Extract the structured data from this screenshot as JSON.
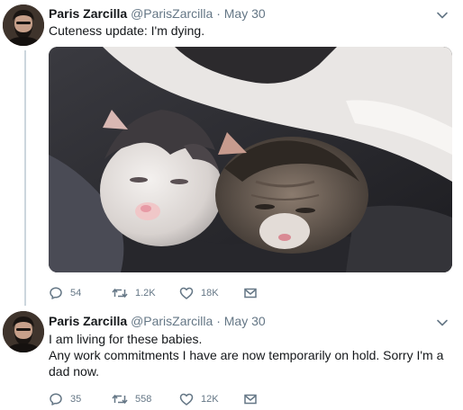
{
  "tweets": [
    {
      "author_name": "Paris Zarcilla",
      "handle": "@ParisZarcilla",
      "separator": "·",
      "date": "May 30",
      "text_lines": [
        "Cuteness update: I'm dying."
      ],
      "media": "photo of two newborn kittens sleeping",
      "replies": "54",
      "retweets": "1.2K",
      "likes": "18K"
    },
    {
      "author_name": "Paris Zarcilla",
      "handle": "@ParisZarcilla",
      "separator": "·",
      "date": "May 30",
      "text_lines": [
        "I am living for these babies.",
        "Any work commitments I have are now temporarily on hold. Sorry I'm a dad now."
      ],
      "replies": "35",
      "retweets": "558",
      "likes": "12K"
    }
  ],
  "colors": {
    "text": "#14171a",
    "secondary": "#657786",
    "thread_line": "#ccd6dd"
  }
}
